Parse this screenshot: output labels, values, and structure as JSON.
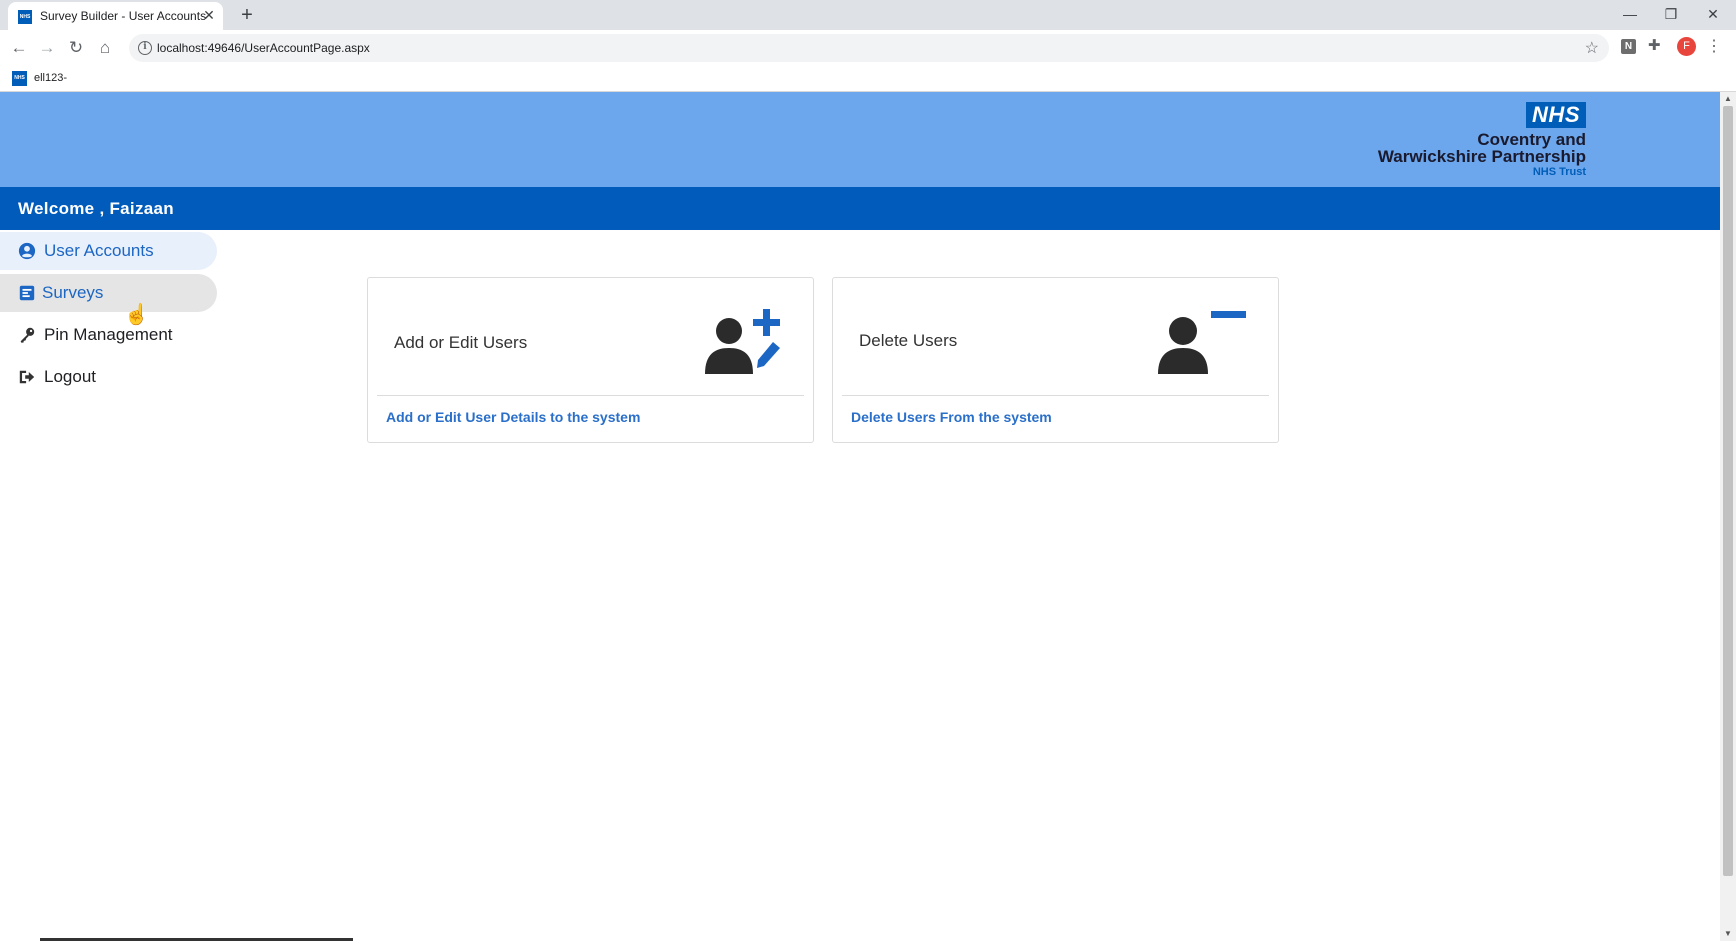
{
  "browser": {
    "tab_title": "Survey Builder - User Accounts",
    "tab_favicon_text": "NHS",
    "url": "localhost:49646/UserAccountPage.aspx",
    "bookmark": "ell123-",
    "bookmark_favicon_text": "NHS",
    "extension_label": "N",
    "profile_initial": "F"
  },
  "header": {
    "logo_badge": "NHS",
    "logo_line1": "Coventry and",
    "logo_line2": "Warwickshire Partnership",
    "logo_line3": "NHS Trust",
    "welcome": "Welcome , Faizaan"
  },
  "sidebar": {
    "items": [
      {
        "label": "User Accounts",
        "icon": "user-circle-icon",
        "state": "active"
      },
      {
        "label": "Surveys",
        "icon": "survey-icon",
        "state": "hover"
      },
      {
        "label": "Pin Management",
        "icon": "key-icon",
        "state": "normal"
      },
      {
        "label": "Logout",
        "icon": "logout-icon",
        "state": "normal"
      }
    ]
  },
  "cards": [
    {
      "title": "Add or Edit Users",
      "link": "Add or Edit User Details to the system",
      "icon": "user-add-edit-icon"
    },
    {
      "title": "Delete Users",
      "link": "Delete Users From the system",
      "icon": "user-remove-icon"
    }
  ],
  "colors": {
    "hero": "#6ca6ec",
    "welcome_bar": "#005bbb",
    "link": "#2a6fc9",
    "icon_accent": "#1c66c4",
    "icon_dark": "#2b2b2b"
  }
}
